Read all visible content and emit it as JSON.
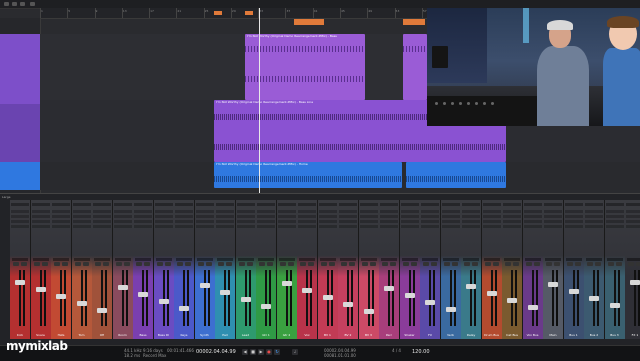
{
  "logo": "mymixlab",
  "arrange": {
    "clip_title_a": "I'm Not Worthy (Original Demo Rearrangement-PMix) - Bass",
    "clip_title_b": "I'm Not Worthy (Original Demo Rearrangement-PMix) - Bass Line",
    "clip_title_c": "I'm Not Worthy (Original Demo Rearrangement-PMix) - Home",
    "ruler_numbers": [
      "1",
      "5",
      "9",
      "13",
      "17",
      "21",
      "25",
      "29",
      "33",
      "37",
      "41",
      "45",
      "49",
      "53",
      "57",
      "61",
      "65",
      "69",
      "73",
      "77",
      "81",
      "85"
    ]
  },
  "mixer": {
    "label": "Large",
    "strip_names": [
      "Kick",
      "Snare",
      "Hats",
      "Tom",
      "OH",
      "Room",
      "Bass",
      "Bass DI",
      "Keys",
      "Synth",
      "Pad",
      "Lead",
      "Gtr 1",
      "Gtr 2",
      "Vox",
      "BV 1",
      "BV 2",
      "BV 3",
      "Perc",
      "Shaker",
      "FX",
      "Verb",
      "Delay",
      "Drum Bus",
      "Inst Bus",
      "Vox Bus",
      "Main",
      "Bus 1",
      "Bus 2",
      "Bus 3",
      "FX 1"
    ]
  },
  "transport": {
    "sample_rate": "44.1 kHz",
    "latency": "18.2 ms",
    "record_max": "9:16 days",
    "time": "00:01:41.466",
    "bars": "00002.04.04.99",
    "loop_start": "00002.04.04.99",
    "loop_end": "00081.01.01.00",
    "meter": "4 / 4",
    "tempo": "120.00",
    "record_label": "Record Max",
    "perf_label": "Performance"
  },
  "colors": {
    "purple": "#7d4fc9",
    "violet": "#9a5cd6",
    "blue": "#2f78e0",
    "orange": "#e07a3a"
  }
}
